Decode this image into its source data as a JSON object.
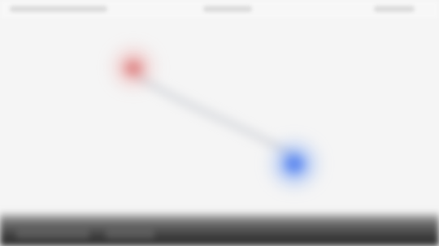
{
  "screen": {
    "background": "#f4f4f4"
  },
  "map": {
    "markers": [
      {
        "name": "start-marker",
        "color": "#e27878"
      },
      {
        "name": "end-marker",
        "color": "#5587f5"
      }
    ],
    "route_color": "#c8cbd2"
  },
  "dock": {
    "color": "#2a2a2a"
  }
}
